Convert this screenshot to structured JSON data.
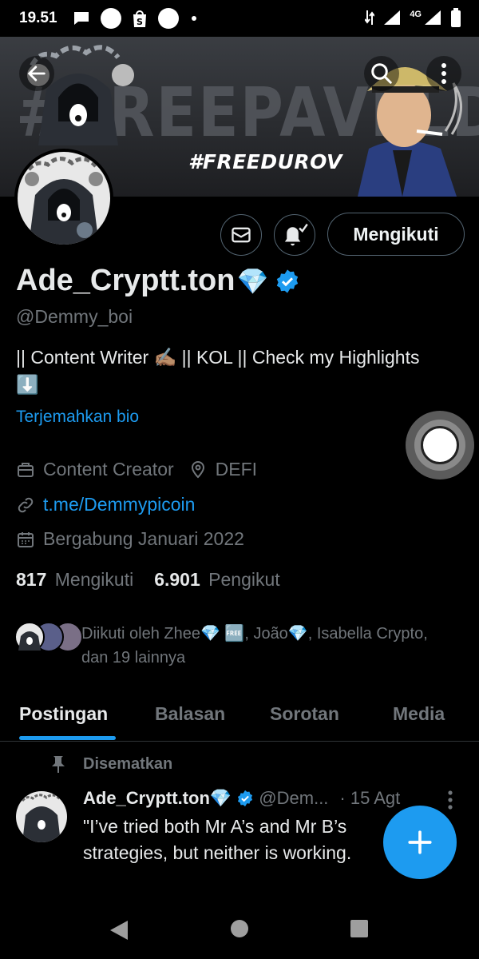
{
  "status_bar": {
    "time": "19.51",
    "network": "4G"
  },
  "banner": {
    "big_text": "#FREEPAVELDUROV",
    "tag": "#FREEDUROV"
  },
  "profile": {
    "name": "Ade_Cryptt.ton",
    "name_emoji": "💎",
    "handle": "@Demmy_boi",
    "bio_line": "|| Content Writer ✍🏽 || KOL || Check my Highlights",
    "bio_emoji": "⬇️",
    "translate_label": "Terjemahkan bio",
    "category": "Content Creator",
    "location": "DEFI",
    "link": "t.me/Demmypicoin",
    "joined": "Bergabung Januari 2022",
    "following_count": "817",
    "following_label": "Mengikuti",
    "followers_count": "6.901",
    "followers_label": "Pengikut",
    "followed_by": "Diikuti oleh Zhee💎 🆓, João💎, Isabella Crypto, dan 19 lainnya"
  },
  "actions": {
    "follow_label": "Mengikuti"
  },
  "tabs": [
    "Postingan",
    "Balasan",
    "Sorotan",
    "Media"
  ],
  "pinned_tweet": {
    "pinned_label": "Disematkan",
    "author": "Ade_Cryptt.ton",
    "author_emoji": "💎",
    "handle": "@Dem...",
    "date": "· 15 Agt",
    "line1": "\"I’ve tried both Mr A’s and Mr B’s",
    "line2": "strategies, but neither is working."
  },
  "colors": {
    "accent": "#1d9bf0",
    "muted": "#71767b",
    "text": "#e7e9ea",
    "background": "#000000"
  }
}
